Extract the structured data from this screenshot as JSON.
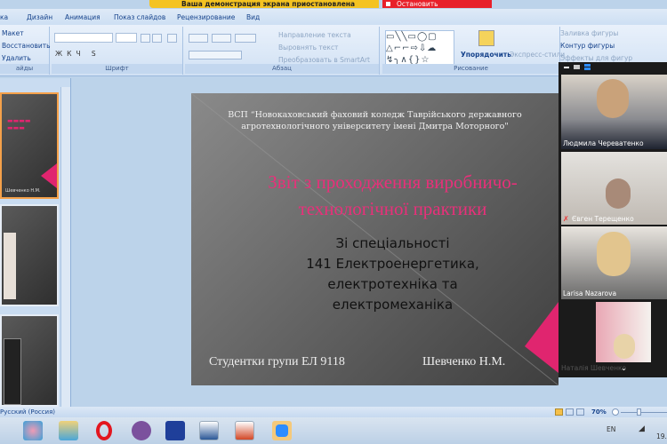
{
  "notification": {
    "paused_text": "Ваша демонстрация экрана приостановлена",
    "stop_label": "Остановить демонстрацию"
  },
  "ribbon": {
    "tabs": [
      "ка",
      "Дизайн",
      "Анимация",
      "Показ слайдов",
      "Рецензирование",
      "Вид"
    ],
    "slides_group": {
      "label": "айды",
      "layout": "Макет",
      "reset": "Восстановить",
      "delete": "Удалить"
    },
    "font_group": {
      "label": "Шрифт"
    },
    "paragraph_group": {
      "label": "Абзац",
      "text_direction": "Направление текста",
      "align_text": "Выровнять текст",
      "smartart": "Преобразовать в SmartArt"
    },
    "drawing_group": {
      "label": "Рисование",
      "arrange": "Упорядочить",
      "quick_styles": "Экспресс-стили",
      "fill": "Заливка фигуры",
      "outline": "Контур фигуры",
      "effects": "Эффекты для фигур"
    }
  },
  "slide": {
    "institution": "ВСП “Новокаховський фаховий коледж Таврійського державного агротехнологічного університету імені Дмитра Моторного\"",
    "title_line1": "Звіт з проходження виробничо-",
    "title_line2": "технологічної практики",
    "sub1": "Зі спеціальності",
    "sub2": "141 Електроенергетика,",
    "sub3": "електротехніка та",
    "sub4": "електромеханіка",
    "group": "Студентки групи ЕЛ 9118",
    "author": "Шевченко Н.М."
  },
  "thumbnail_author": "Шевченко Н.М.",
  "participants": [
    "Людмила Череватенко",
    "Євген Терещенко",
    "Larisa Nazarova",
    "Наталія Шевченко"
  ],
  "status": {
    "language": "Русский (Россия)",
    "zoom": "70%"
  },
  "taskbar": {
    "lang": "EN",
    "clock": "19."
  },
  "colors": {
    "accent_pink": "#e0256f",
    "notify_yellow": "#f4c322",
    "stop_red": "#e8202a"
  }
}
